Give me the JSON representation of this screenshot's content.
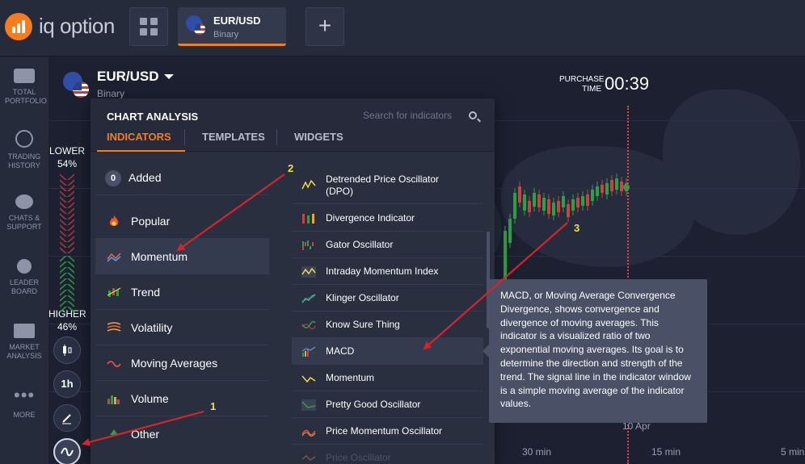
{
  "brand": {
    "name": "iq option",
    "color": "#f57c1f"
  },
  "top_tabs": [
    {
      "title": "EUR/USD",
      "subtitle": "Binary",
      "icon": "eur-usd-flag-icon"
    }
  ],
  "new_tab": {
    "label": "+"
  },
  "sidebar": {
    "items": [
      {
        "label": "TOTAL PORTFOLIO",
        "icon": "briefcase-icon"
      },
      {
        "label": "TRADING HISTORY",
        "icon": "history-clock-icon"
      },
      {
        "label": "CHATS & SUPPORT",
        "icon": "chat-bubble-icon"
      },
      {
        "label": "LEADER BOARD",
        "icon": "medal-icon"
      },
      {
        "label": "MARKET ANALYSIS",
        "icon": "news-icon"
      },
      {
        "label": "MORE",
        "icon": "more-dots-icon"
      }
    ]
  },
  "chart": {
    "asset_title": "EUR/USD",
    "asset_subtitle": "Binary",
    "lower": {
      "label": "LOWER",
      "percent": "54%"
    },
    "higher": {
      "label": "HIGHER",
      "percent": "46%"
    },
    "purchase_label_1": "PURCHASE",
    "purchase_label_2": "TIME",
    "purchase_time": "00:39",
    "date_label": "10 Apr",
    "timeframes": [
      "30 min",
      "15 min",
      "5 min"
    ],
    "tools": [
      {
        "name": "candles",
        "label": ""
      },
      {
        "name": "period",
        "label": "1h"
      },
      {
        "name": "draw",
        "label": ""
      },
      {
        "name": "indicators",
        "label": ""
      }
    ]
  },
  "panel": {
    "title": "CHART ANALYSIS",
    "search_placeholder": "Search for indicators",
    "tabs": [
      "INDICATORS",
      "TEMPLATES",
      "WIDGETS"
    ],
    "active_tab": "INDICATORS",
    "added_count": "0",
    "categories": [
      {
        "label": "Added",
        "icon": "count-badge"
      },
      {
        "label": "Popular",
        "icon": "fire-icon"
      },
      {
        "label": "Momentum",
        "icon": "momentum-icon"
      },
      {
        "label": "Trend",
        "icon": "trend-icon"
      },
      {
        "label": "Volatility",
        "icon": "volatility-icon"
      },
      {
        "label": "Moving Averages",
        "icon": "moving-average-icon"
      },
      {
        "label": "Volume",
        "icon": "volume-bars-icon"
      },
      {
        "label": "Other",
        "icon": "other-icon"
      }
    ],
    "active_category": "Momentum",
    "indicators": [
      {
        "label": "Detrended Price Oscillator",
        "label2": "(DPO)"
      },
      {
        "label": "Divergence Indicator"
      },
      {
        "label": "Gator Oscillator"
      },
      {
        "label": "Intraday Momentum Index"
      },
      {
        "label": "Klinger Oscillator"
      },
      {
        "label": "Know Sure Thing"
      },
      {
        "label": "MACD"
      },
      {
        "label": "Momentum"
      },
      {
        "label": "Pretty Good Oscillator"
      },
      {
        "label": "Price Momentum Oscillator"
      },
      {
        "label": "Price Oscillator"
      }
    ],
    "active_indicator": "MACD"
  },
  "tooltip": {
    "text": "MACD, or Moving Average Convergence Divergence, shows convergence and divergence of moving averages. This indicator is a visualized ratio of two exponential moving averages. Its goal is to determine the direction and strength of the trend. The signal line in the indicator window is a simple moving average of the indicator values."
  },
  "annotations": [
    "1",
    "2",
    "3"
  ],
  "colors": {
    "accent": "#f57c1f",
    "up": "#2f9e45",
    "down": "#c4463f",
    "annotation": "#f0dc4a",
    "arrow": "#d8232a"
  }
}
